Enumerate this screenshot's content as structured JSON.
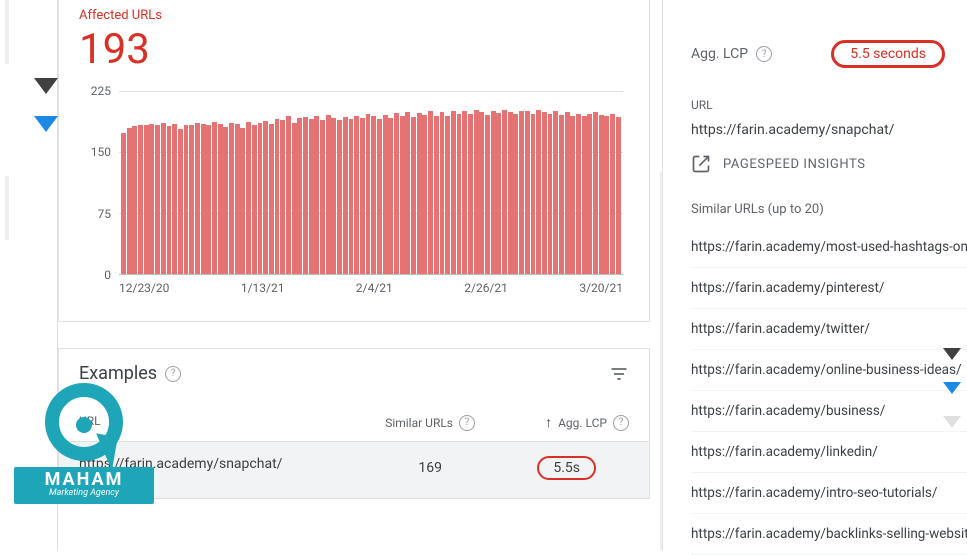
{
  "affected": {
    "label": "Affected URLs",
    "value": "193"
  },
  "chart_data": {
    "type": "bar",
    "title": "",
    "xlabel": "",
    "ylabel": "",
    "ylim": [
      0,
      225
    ],
    "categories": [
      "12/23/20",
      "1/13/21",
      "2/4/21",
      "2/26/21",
      "3/20/21"
    ],
    "y_ticks": [
      0,
      75,
      150,
      225
    ],
    "values": [
      173,
      179,
      181,
      183,
      182,
      184,
      183,
      185,
      181,
      184,
      178,
      183,
      182,
      185,
      184,
      183,
      186,
      184,
      180,
      185,
      184,
      179,
      186,
      183,
      185,
      187,
      184,
      190,
      188,
      193,
      185,
      191,
      192,
      190,
      193,
      188,
      195,
      191,
      189,
      192,
      190,
      194,
      191,
      196,
      193,
      190,
      195,
      191,
      197,
      193,
      198,
      192,
      197,
      195,
      199,
      193,
      198,
      194,
      199,
      196,
      200,
      196,
      201,
      198,
      195,
      199,
      197,
      201,
      198,
      196,
      200,
      199,
      196,
      201,
      198,
      196,
      199,
      195,
      198,
      194,
      196,
      193,
      196,
      198,
      195,
      193,
      196,
      192
    ]
  },
  "examples": {
    "title": "Examples",
    "columns": {
      "url": "URL",
      "similar": "Similar URLs",
      "agg_lcp": "Agg. LCP"
    },
    "row": {
      "url": "https://farin.academy/snapchat/",
      "similar": "169",
      "agg_lcp": "5.5s"
    }
  },
  "side": {
    "agg_lcp_label": "Agg. LCP",
    "agg_lcp_value": "5.5 seconds",
    "url_label": "URL",
    "url_value": "https://farin.academy/snapchat/",
    "psi_label": "PAGESPEED INSIGHTS",
    "similar_label": "Similar URLs (up to 20)",
    "similar_urls": [
      "https://farin.academy/most-used-hashtags-on-in",
      "https://farin.academy/pinterest/",
      "https://farin.academy/twitter/",
      "https://farin.academy/online-business-ideas/",
      "https://farin.academy/business/",
      "https://farin.academy/linkedin/",
      "https://farin.academy/intro-seo-tutorials/",
      "https://farin.academy/backlinks-selling-website"
    ]
  },
  "logo": {
    "name": "MAHAM",
    "tag": "Marketing Agency"
  }
}
